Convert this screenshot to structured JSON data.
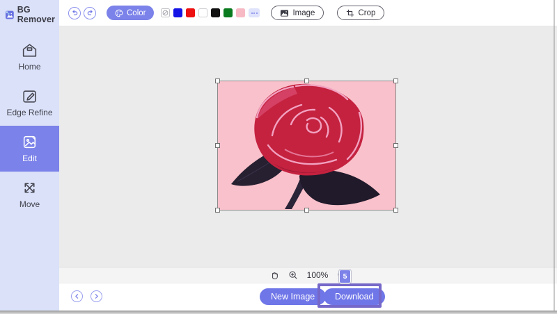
{
  "app": {
    "title": "BG Remover"
  },
  "sidebar": {
    "items": [
      {
        "label": "Home"
      },
      {
        "label": "Edge Refine"
      },
      {
        "label": "Edit",
        "active": true
      },
      {
        "label": "Move"
      }
    ]
  },
  "toolbar": {
    "color_button_label": "Color",
    "swatches": [
      {
        "name": "none",
        "color": ""
      },
      {
        "name": "blue",
        "color": "#1414e6"
      },
      {
        "name": "red",
        "color": "#ee1111"
      },
      {
        "name": "white",
        "color": "#ffffff"
      },
      {
        "name": "black",
        "color": "#111111"
      },
      {
        "name": "green",
        "color": "#0a7a1e"
      },
      {
        "name": "pink",
        "color": "#f7bac5"
      }
    ],
    "image_button_label": "Image",
    "crop_button_label": "Crop"
  },
  "canvas": {
    "image_description": "red rose with dark leaves on pink background",
    "image_background_color": "#f9c1cb"
  },
  "zoom_controls": {
    "zoom_level": "100%",
    "badge": "5"
  },
  "footer": {
    "new_image_label": "New Image",
    "download_label": "Download"
  },
  "colors": {
    "accent": "#7b82e9",
    "sidebar_bg": "#dae1f8",
    "canvas_bg": "#ebebeb",
    "highlight_border": "#7568c9"
  }
}
